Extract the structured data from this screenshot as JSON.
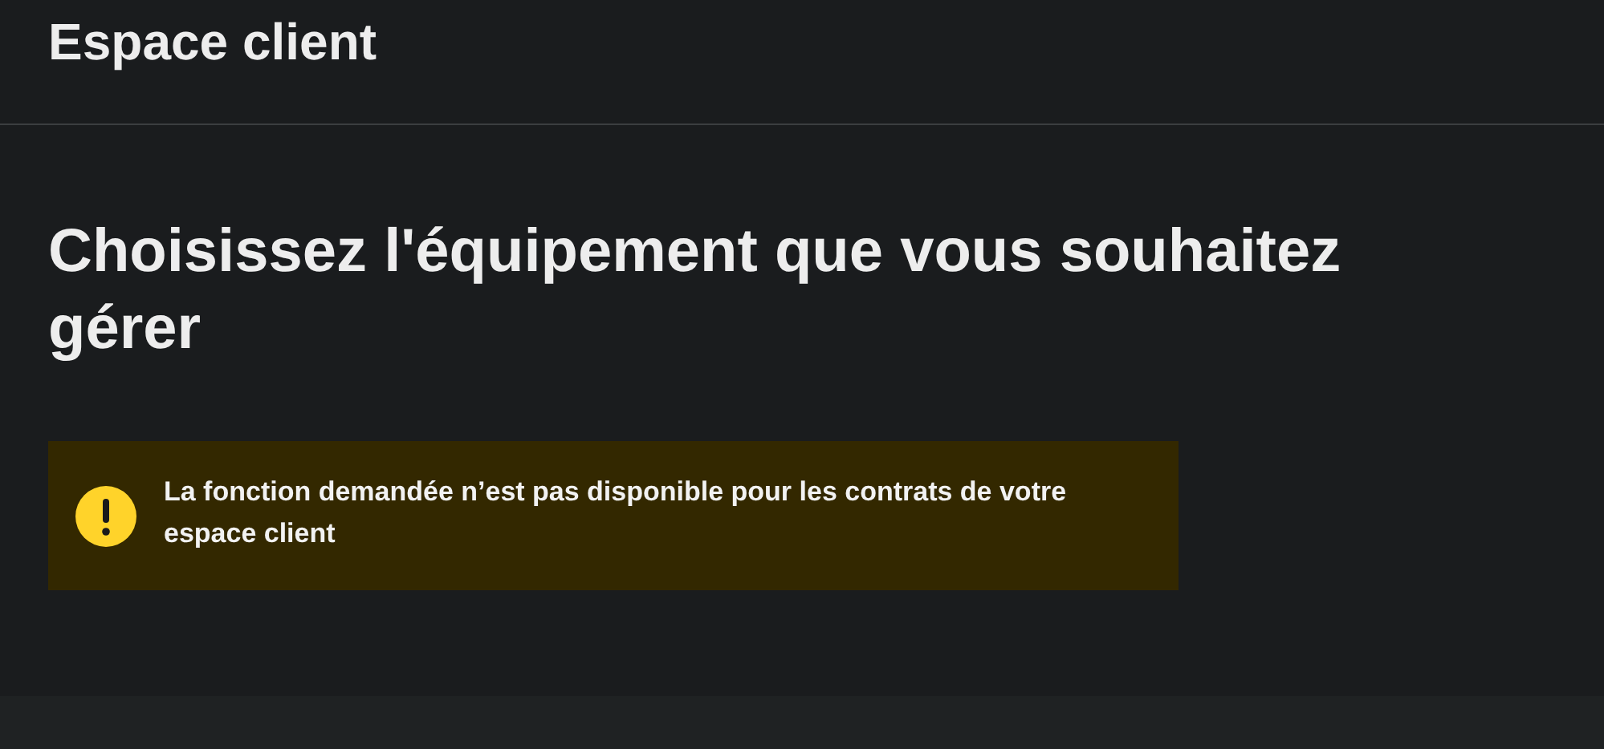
{
  "header": {
    "title": "Espace client"
  },
  "heading": "Choisissez l'équipement que vous souhaitez gérer",
  "alert": {
    "kind": "warning",
    "message": "La fonction demandée n’est pas disponible pour les contrats de votre espace client"
  }
}
